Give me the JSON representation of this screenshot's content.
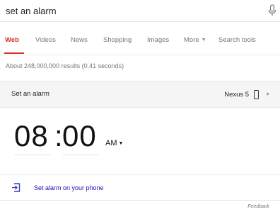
{
  "search": {
    "query": "set an alarm"
  },
  "tabs": [
    {
      "label": "Web",
      "active": true
    },
    {
      "label": "Videos"
    },
    {
      "label": "News"
    },
    {
      "label": "Shopping"
    },
    {
      "label": "Images"
    },
    {
      "label": "More"
    },
    {
      "label": "Search tools"
    }
  ],
  "results_stats": "About 248,000,000 results (0.41 seconds)",
  "card": {
    "title": "Set an alarm",
    "device": "Nexus 5",
    "time": {
      "hours": "08",
      "separator": ":",
      "minutes": "00",
      "period": "AM"
    },
    "action_label": "Set alarm on your phone"
  },
  "feedback_label": "Feedback",
  "colors": {
    "active_tab": "#d93025",
    "link": "#1a0dab",
    "icon_accent": "#3b3dbf"
  },
  "icons": [
    "microphone-icon",
    "phone-icon",
    "dropdown-caret-icon",
    "send-to-phone-icon"
  ]
}
